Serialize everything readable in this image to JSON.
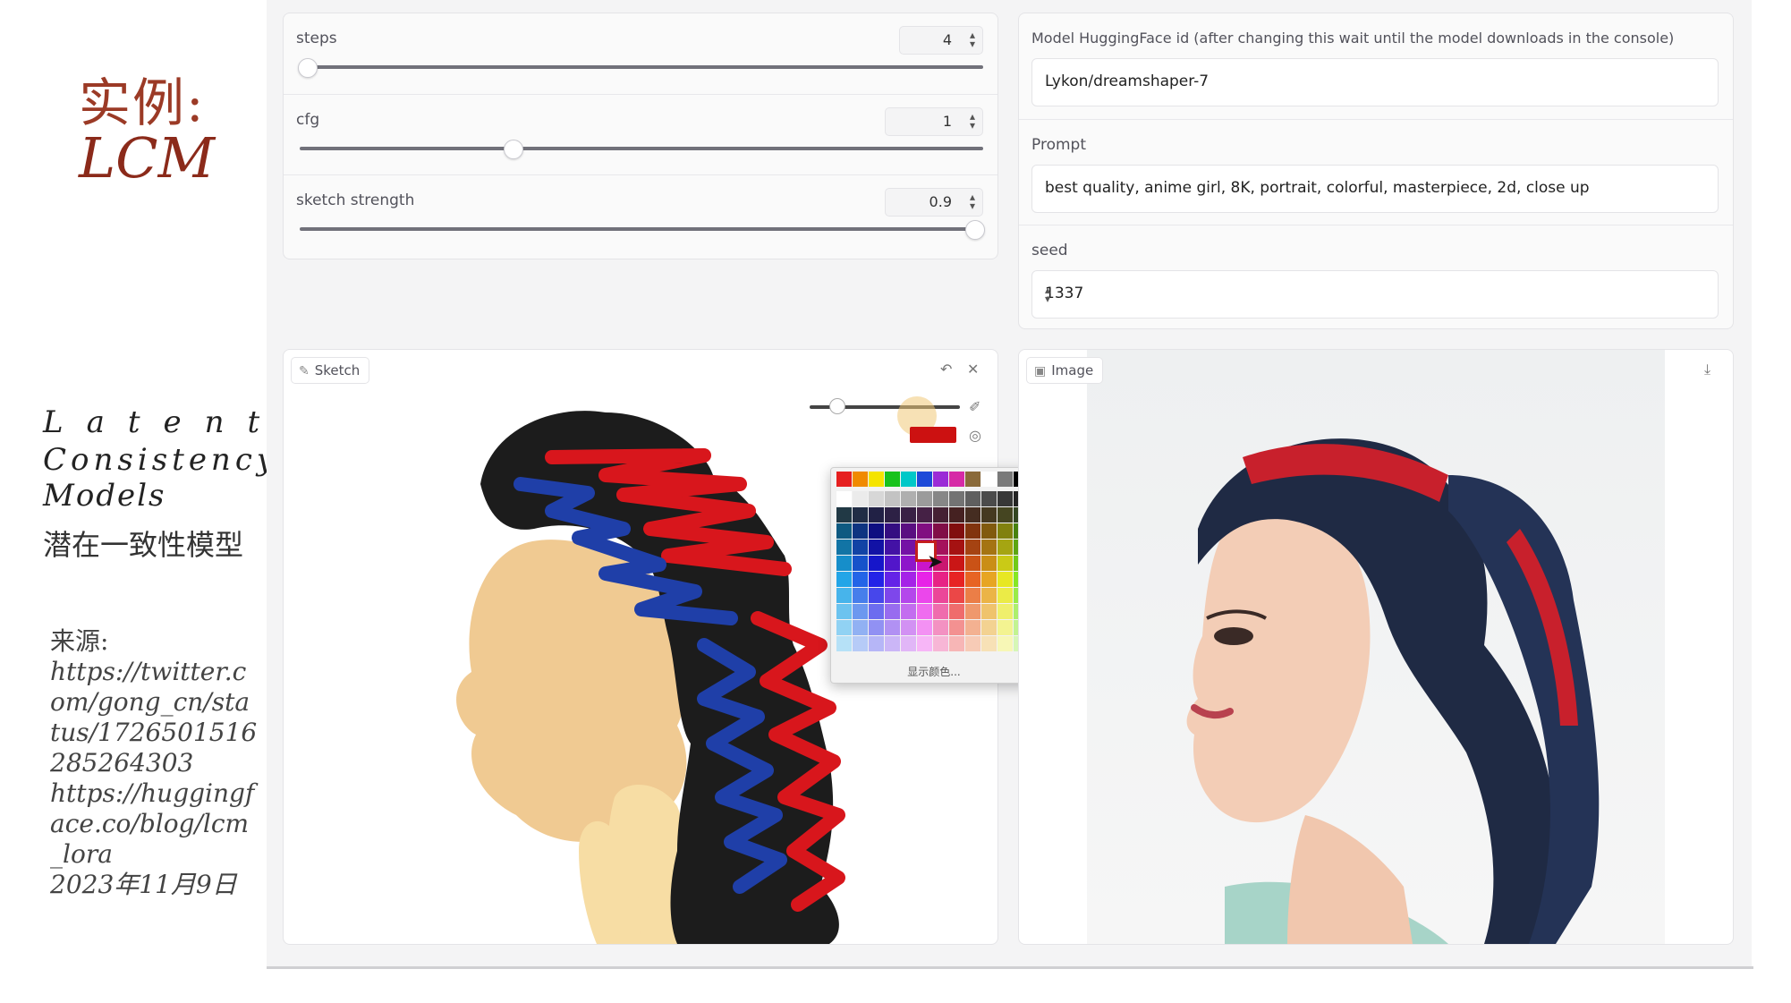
{
  "slide": {
    "title_line1": "实例:",
    "title_line2": "LCM",
    "lcm_line1": "Latent",
    "lcm_line2": "Consistency",
    "lcm_line3": "Models",
    "lcm_chinese": "潜在一致性模型",
    "source_label": "来源:",
    "source_url1": "https://twitter.com/gong_cn/status/1726501516285264303",
    "source_url2": "https://huggingface.co/blog/lcm_lora",
    "source_date": "2023年11月9日"
  },
  "controls": {
    "steps": {
      "label": "steps",
      "value": "4",
      "fraction": 0.0
    },
    "cfg": {
      "label": "cfg",
      "value": "1",
      "fraction": 0.32
    },
    "sketch_strength": {
      "label": "sketch strength",
      "value": "0.9",
      "fraction": 1.0
    }
  },
  "settings": {
    "model_label": "Model HuggingFace id (after changing this wait until the model downloads in the console)",
    "model_value": "Lykon/dreamshaper-7",
    "prompt_label": "Prompt",
    "prompt_value": "best quality, anime girl, 8K, portrait, colorful, masterpiece, 2d, close up",
    "seed_label": "seed",
    "seed_value": "1337"
  },
  "sketch": {
    "tab_label": "Sketch",
    "brush_color": "#cc1111",
    "palette_more_label": "显示颜色..."
  },
  "image": {
    "tab_label": "Image"
  },
  "colors": {
    "hair_dark": "#1c1c1c",
    "hair_red": "#d8161c",
    "hair_blue": "#1f3fa8",
    "skin": "#f0ca92",
    "neck": "#f7dda4"
  }
}
